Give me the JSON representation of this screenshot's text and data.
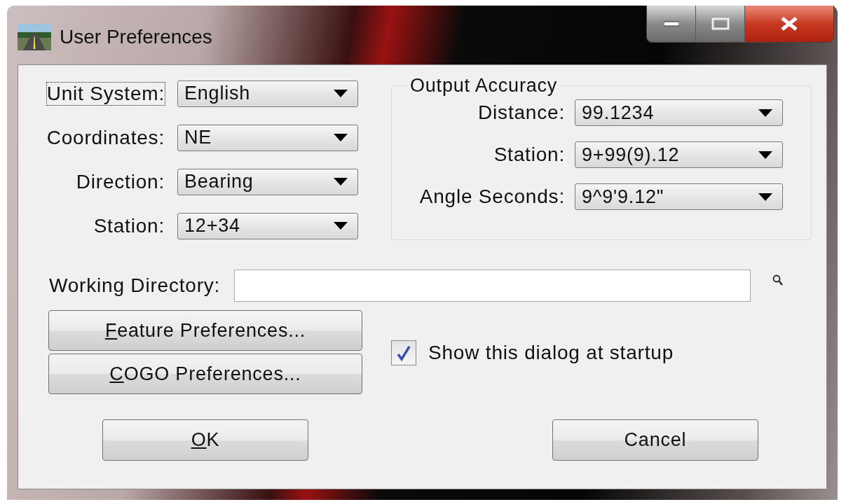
{
  "window": {
    "title": "User Preferences"
  },
  "left_settings": [
    {
      "label": "Unit System:",
      "value": "English",
      "focused": true
    },
    {
      "label": "Coordinates:",
      "value": "NE",
      "focused": false
    },
    {
      "label": "Direction:",
      "value": "Bearing",
      "focused": false
    },
    {
      "label": "Station:",
      "value": "12+34",
      "focused": false
    }
  ],
  "output_accuracy": {
    "title": "Output Accuracy",
    "settings": [
      {
        "label": "Distance:",
        "value": "99.1234"
      },
      {
        "label": "Station:",
        "value": "9+99(9).12"
      },
      {
        "label": "Angle Seconds:",
        "value": "9^9'9.12\""
      }
    ]
  },
  "working_directory": {
    "label": "Working Directory:"
  },
  "preference_buttons": [
    {
      "label": "Feature Preferences...",
      "underline_first": true
    },
    {
      "label": "COGO Preferences...",
      "underline_first": true
    }
  ],
  "show_at_startup": {
    "label": "Show this dialog at startup",
    "checked": true
  },
  "dialog_buttons": [
    {
      "label": "OK",
      "underline_first": true
    },
    {
      "label": "Cancel",
      "underline_first": false
    }
  ]
}
